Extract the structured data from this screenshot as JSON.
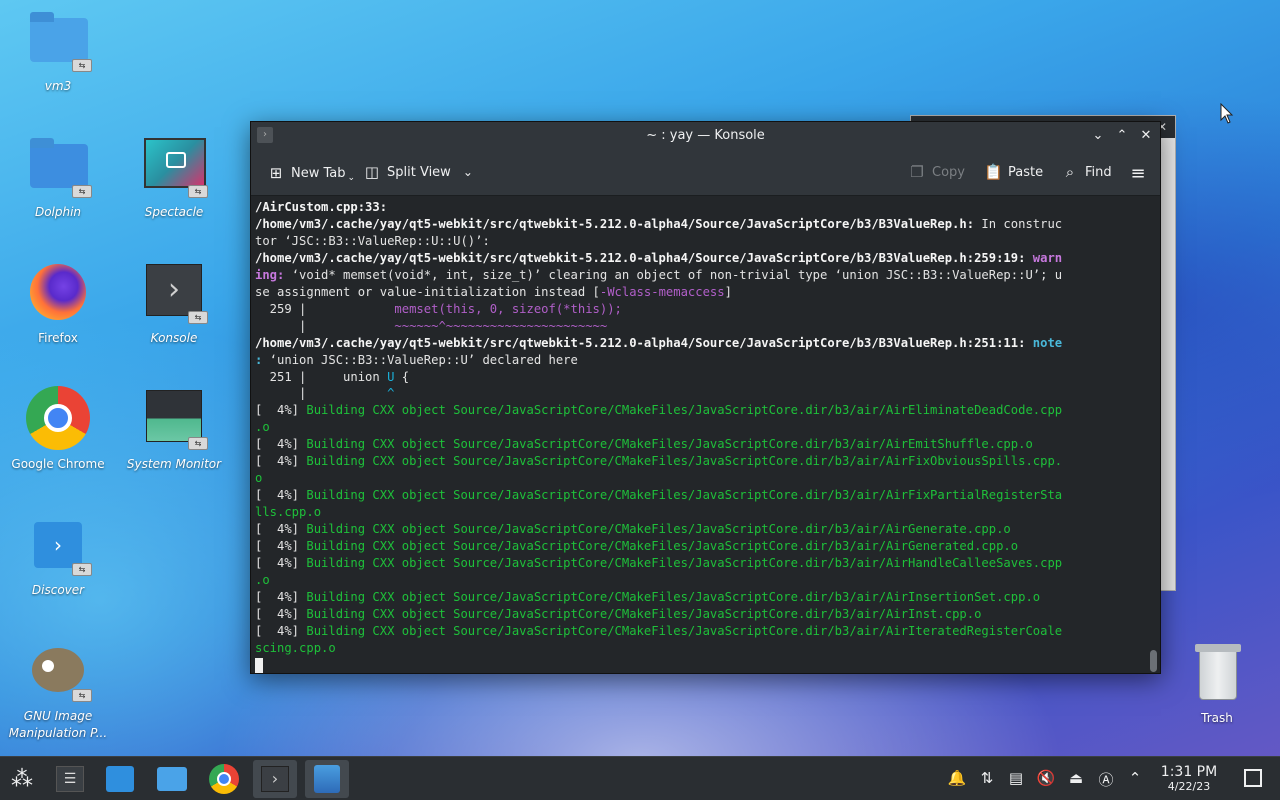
{
  "desktop": {
    "icons": [
      {
        "label": "vm3"
      },
      {
        "label": "Dolphin"
      },
      {
        "label": "Spectacle"
      },
      {
        "label": "Firefox"
      },
      {
        "label": "Konsole"
      },
      {
        "label": "Google Chrome"
      },
      {
        "label": "System Monitor"
      },
      {
        "label": "Discover"
      },
      {
        "label": "GNU Image Manipulation P..."
      },
      {
        "label": "Trash"
      }
    ]
  },
  "konsole": {
    "title": "~ : yay — Konsole",
    "toolbar": {
      "new_tab": "New Tab",
      "split_view": "Split View",
      "copy": "Copy",
      "paste": "Paste",
      "find": "Find"
    },
    "lines": [
      "/AirCustom.cpp:33:",
      "/home/vm3/.cache/yay/qt5-webkit/src/qtwebkit-5.212.0-alpha4/Source/JavaScriptCore/b3/B3ValueRep.h:",
      " In construc",
      "tor ‘JSC::B3::ValueRep::U::U()’:",
      "/home/vm3/.cache/yay/qt5-webkit/src/qtwebkit-5.212.0-alpha4/Source/JavaScriptCore/b3/B3ValueRep.h:259:19: ",
      "warn",
      "ing:",
      " ‘void* memset(void*, int, size_t)’ clearing an object of non-trivial type ‘union JSC::B3::ValueRep::U’; u",
      "se assignment or value-initialization instead [",
      "-Wclass-memaccess",
      "]",
      "  259 |            ",
      "memset(this, 0, sizeof(*this));",
      "      |            ",
      "~~~~~~^~~~~~~~~~~~~~~~~~~~~~~",
      "/home/vm3/.cache/yay/qt5-webkit/src/qtwebkit-5.212.0-alpha4/Source/JavaScriptCore/b3/B3ValueRep.h:251:11: ",
      "note",
      ":",
      " ‘union JSC::B3::ValueRep::U’ declared here",
      "  251 |     union ",
      "U",
      " {",
      "      |           ",
      "^",
      "[  4%] ",
      "Building CXX object Source/JavaScriptCore/CMakeFiles/JavaScriptCore.dir/b3/air/AirEliminateDeadCode.cpp",
      ".o",
      "Building CXX object Source/JavaScriptCore/CMakeFiles/JavaScriptCore.dir/b3/air/AirEmitShuffle.cpp.o",
      "Building CXX object Source/JavaScriptCore/CMakeFiles/JavaScriptCore.dir/b3/air/AirFixObviousSpills.cpp.",
      "o",
      "Building CXX object Source/JavaScriptCore/CMakeFiles/JavaScriptCore.dir/b3/air/AirFixPartialRegisterSta",
      "lls.cpp.o",
      "Building CXX object Source/JavaScriptCore/CMakeFiles/JavaScriptCore.dir/b3/air/AirGenerate.cpp.o",
      "Building CXX object Source/JavaScriptCore/CMakeFiles/JavaScriptCore.dir/b3/air/AirGenerated.cpp.o",
      "Building CXX object Source/JavaScriptCore/CMakeFiles/JavaScriptCore.dir/b3/air/AirHandleCalleeSaves.cpp",
      ".o",
      "Building CXX object Source/JavaScriptCore/CMakeFiles/JavaScriptCore.dir/b3/air/AirInsertionSet.cpp.o",
      "Building CXX object Source/JavaScriptCore/CMakeFiles/JavaScriptCore.dir/b3/air/AirInst.cpp.o",
      "Building CXX object Source/JavaScriptCore/CMakeFiles/JavaScriptCore.dir/b3/air/AirIteratedRegisterCoale",
      "scing.cpp.o"
    ]
  },
  "taskbar": {
    "clock_time": "1:31 PM",
    "clock_date": "4/22/23"
  },
  "colors": {
    "terminal_bg": "#232629",
    "build_green": "#1ec03a",
    "warning_magenta": "#c678dd",
    "note_cyan": "#49b8d9"
  }
}
